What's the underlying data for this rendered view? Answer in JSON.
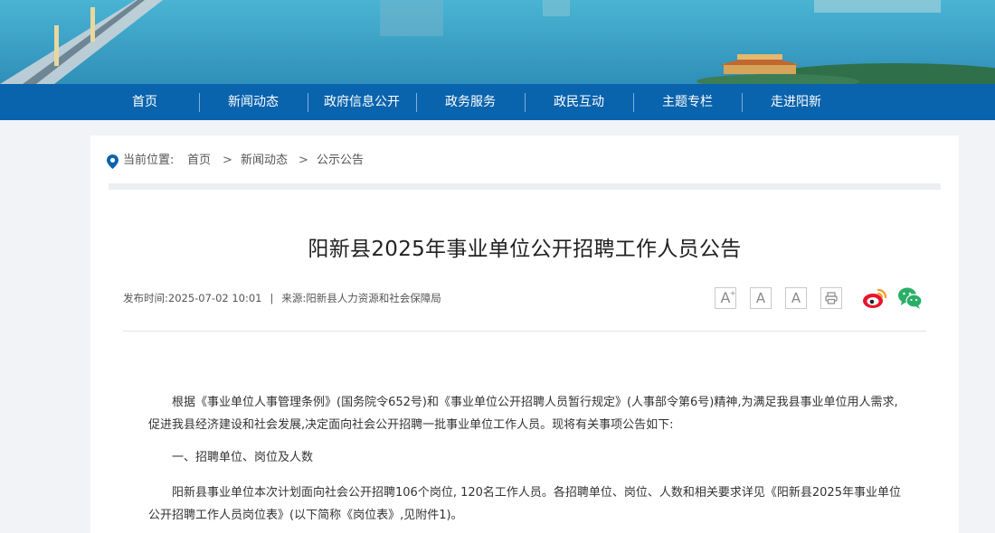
{
  "nav": {
    "items": [
      "首页",
      "新闻动态",
      "政府信息公开",
      "政务服务",
      "政民互动",
      "主题专栏",
      "走进阳新"
    ]
  },
  "breadcrumb": {
    "label": "当前位置:",
    "items": [
      "首页",
      "新闻动态",
      "公示公告"
    ],
    "separator": ">"
  },
  "article": {
    "title": "阳新县2025年事业单位公开招聘工作人员公告",
    "publish_time": "发布时间:2025-07-02 10:01",
    "meta_separator": "|",
    "source": "来源:阳新县人力资源和社会保障局",
    "paragraphs": [
      "根据《事业单位人事管理条例》(国务院令652号)和《事业单位公开招聘人员暂行规定》(人事部令第6号)精神,为满足我县事业单位用人需求,促进我县经济建设和社会发展,决定面向社会公开招聘一批事业单位工作人员。现将有关事项公告如下:",
      "一、招聘单位、岗位及人数",
      "阳新县事业单位本次计划面向社会公开招聘106个岗位, 120名工作人员。各招聘单位、岗位、人数和相关要求详见《阳新县2025年事业单位公开招聘工作人员岗位表》(以下简称《岗位表》,见附件1)。"
    ]
  },
  "tools": {
    "font_large": "A",
    "font_medium": "A",
    "font_small": "A",
    "icons": [
      "font-increase-icon",
      "font-medium-icon",
      "font-decrease-icon",
      "print-icon",
      "weibo-icon",
      "wechat-icon"
    ]
  },
  "colors": {
    "nav_bg": "#0a63ad",
    "page_bg": "#f1f3f6",
    "weibo": "#e6162d",
    "wechat": "#2aae67"
  }
}
